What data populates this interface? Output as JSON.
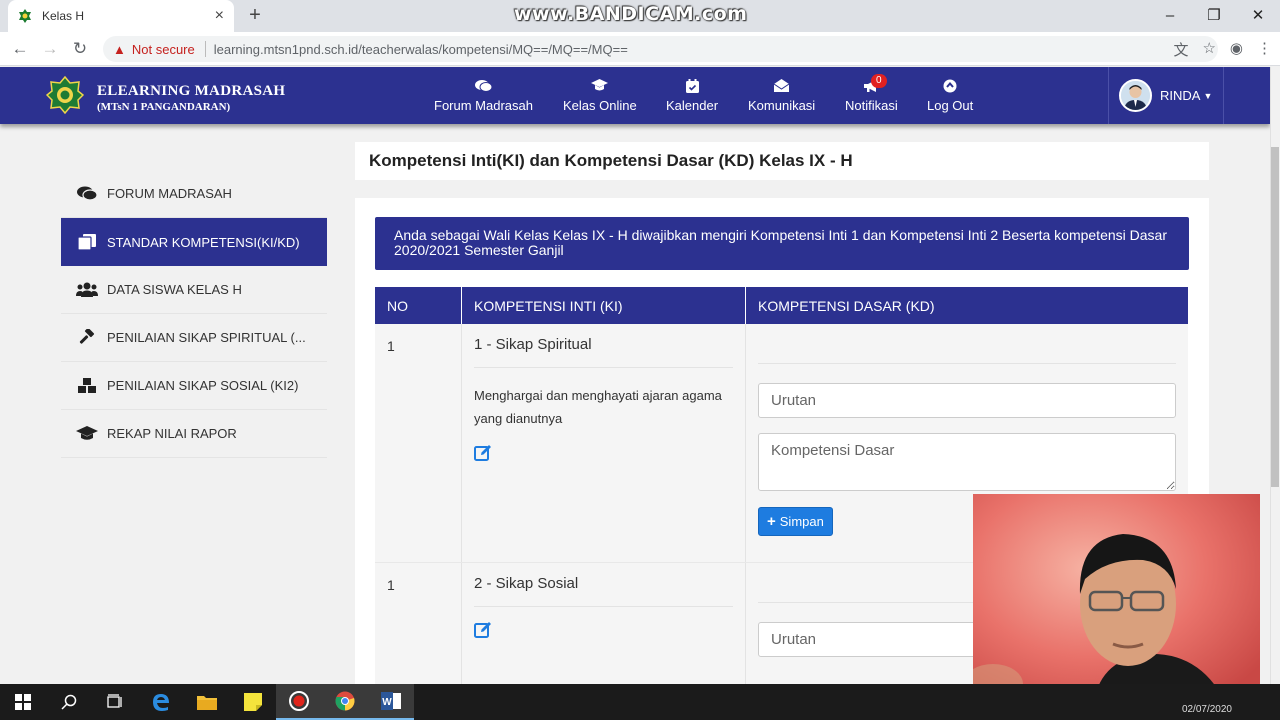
{
  "browser": {
    "tab_title": "Kelas H",
    "tab_close": "×",
    "new_tab": "+",
    "watermark": "www.BANDICAM.com",
    "not_secure": "Not secure",
    "url": "learning.mtsn1pnd.sch.id/teacherwalas/kompetensi/MQ==/MQ==/MQ=="
  },
  "header": {
    "brand_title": "ELEARNING MADRASAH",
    "brand_subtitle": "(MTsN 1 PANGANDARAN)",
    "nav": [
      {
        "label": "Forum Madrasah",
        "icon": "comments-icon"
      },
      {
        "label": "Kelas Online",
        "icon": "graduation-cap-icon"
      },
      {
        "label": "Kalender",
        "icon": "calendar-icon"
      },
      {
        "label": "Komunikasi",
        "icon": "envelope-icon"
      },
      {
        "label": "Notifikasi",
        "icon": "bullhorn-icon",
        "badge": "0"
      },
      {
        "label": "Log Out",
        "icon": "power-icon"
      }
    ],
    "user_name": "RINDA"
  },
  "sidebar": {
    "items": [
      {
        "label": "FORUM MADRASAH",
        "icon": "comments-icon"
      },
      {
        "label": "STANDAR KOMPETENSI(KI/KD)",
        "icon": "copy-icon",
        "active": true
      },
      {
        "label": "DATA SISWA KELAS H",
        "icon": "users-icon"
      },
      {
        "label": "PENILAIAN SIKAP SPIRITUAL (...",
        "icon": "gavel-icon"
      },
      {
        "label": "PENILAIAN SIKAP SOSIAL (KI2)",
        "icon": "cubes-icon"
      },
      {
        "label": "REKAP NILAI RAPOR",
        "icon": "graduation-cap-icon"
      }
    ]
  },
  "main": {
    "title": "Kompetensi Inti(KI) dan Kompetensi Dasar (KD) Kelas IX - H",
    "notice": "Anda sebagai Wali Kelas Kelas IX - H diwajibkan mengiri Kompetensi Inti 1 dan Kompetensi Inti 2 Beserta kompetensi Dasar 2020/2021 Semester Ganjil",
    "table": {
      "headers": [
        "NO",
        "KOMPETENSI INTI (KI)",
        "KOMPETENSI DASAR (KD)"
      ],
      "rows": [
        {
          "no": "1",
          "ki_title": "1 - Sikap Spiritual",
          "ki_desc": "Menghargai dan menghayati ajaran agama yang dianutnya",
          "urutan_placeholder": "Urutan",
          "kd_placeholder": "Kompetensi Dasar",
          "save_label": "Simpan"
        },
        {
          "no": "1",
          "ki_title": "2 - Sikap Sosial",
          "ki_desc": "",
          "urutan_placeholder": "Urutan"
        }
      ]
    }
  },
  "taskbar": {
    "date": "02/07/2020"
  },
  "colors": {
    "primary": "#2c3190",
    "button": "#1e7ce0",
    "badge": "#e02121"
  }
}
